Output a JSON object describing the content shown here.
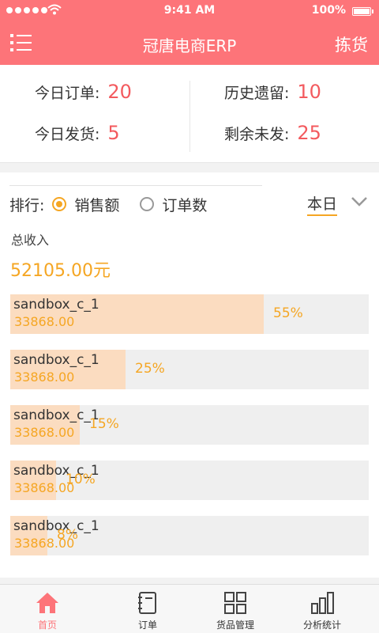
{
  "status": {
    "time": "9:41 AM",
    "battery": "100%"
  },
  "nav": {
    "title": "冠唐电商ERP",
    "action": "拣货"
  },
  "summary": {
    "today_orders": {
      "label": "今日订单:",
      "value": "20"
    },
    "history_left": {
      "label": "历史遗留:",
      "value": "10"
    },
    "today_shipped": {
      "label": "今日发货:",
      "value": "5"
    },
    "remaining": {
      "label": "剩余未发:",
      "value": "25"
    }
  },
  "sort": {
    "label": "排行:",
    "options": [
      {
        "label": "销售额",
        "selected": true
      },
      {
        "label": "订单数",
        "selected": false
      }
    ],
    "period": "本日"
  },
  "revenue": {
    "label": "总收入",
    "value": "52105.00元"
  },
  "ranking": [
    {
      "name": "sandbox_c_1",
      "amount": "33868.00",
      "percent_label": "55%",
      "percent": 0.55
    },
    {
      "name": "sandbox_c_1",
      "amount": "33868.00",
      "percent_label": "25%",
      "percent": 0.25
    },
    {
      "name": "sandbox_c_1",
      "amount": "33868.00",
      "percent_label": "15%",
      "percent": 0.15
    },
    {
      "name": "sandbox_c_1",
      "amount": "33868.00",
      "percent_label": "10%",
      "percent": 0.1
    },
    {
      "name": "sandbox_c_1",
      "amount": "33868.00",
      "percent_label": "8%",
      "percent": 0.08
    }
  ],
  "tabs": [
    {
      "label": "首页",
      "icon": "home-icon",
      "active": true
    },
    {
      "label": "订单",
      "icon": "notebook-icon",
      "active": false
    },
    {
      "label": "货品管理",
      "icon": "grid-icon",
      "active": false
    },
    {
      "label": "分析统计",
      "icon": "bar-chart-icon",
      "active": false
    }
  ],
  "colors": {
    "primary": "#fd7479",
    "accent": "#f5a623",
    "value_red": "#f35a5e",
    "bar_fill": "#fbdcc0"
  }
}
